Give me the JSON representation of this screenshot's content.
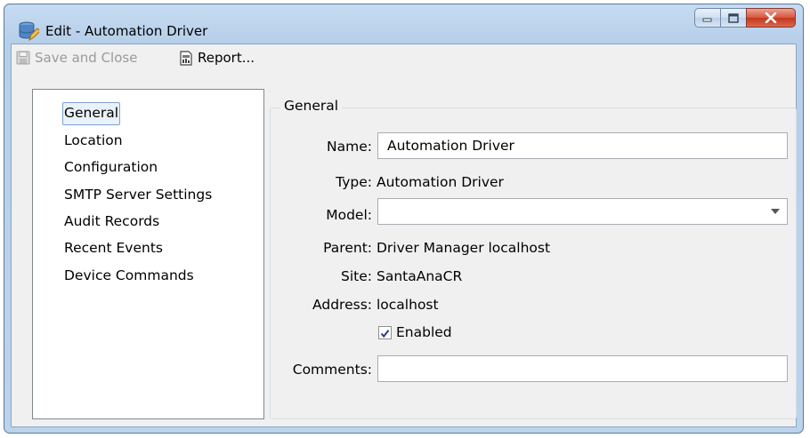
{
  "window": {
    "title": "Edit - Automation Driver"
  },
  "toolbar": {
    "save_label": "Save and Close",
    "report_label": "Report..."
  },
  "nav": {
    "items": [
      {
        "label": "General",
        "selected": true
      },
      {
        "label": "Location"
      },
      {
        "label": "Configuration"
      },
      {
        "label": "SMTP Server Settings"
      },
      {
        "label": "Audit Records"
      },
      {
        "label": "Recent Events"
      },
      {
        "label": "Device Commands"
      }
    ]
  },
  "general": {
    "group_title": "General",
    "name_label": "Name:",
    "name_value": "Automation Driver",
    "type_label": "Type:",
    "type_value": "Automation Driver",
    "model_label": "Model:",
    "model_value": "",
    "parent_label": "Parent:",
    "parent_value": "Driver Manager localhost",
    "site_label": "Site:",
    "site_value": "SantaAnaCR",
    "address_label": "Address:",
    "address_value": "localhost",
    "enabled_label": "Enabled",
    "enabled_checked": true,
    "comments_label": "Comments:",
    "comments_value": ""
  },
  "icons": {
    "app": "database-edit-icon",
    "save": "floppy-disk-icon",
    "report": "report-document-icon"
  }
}
